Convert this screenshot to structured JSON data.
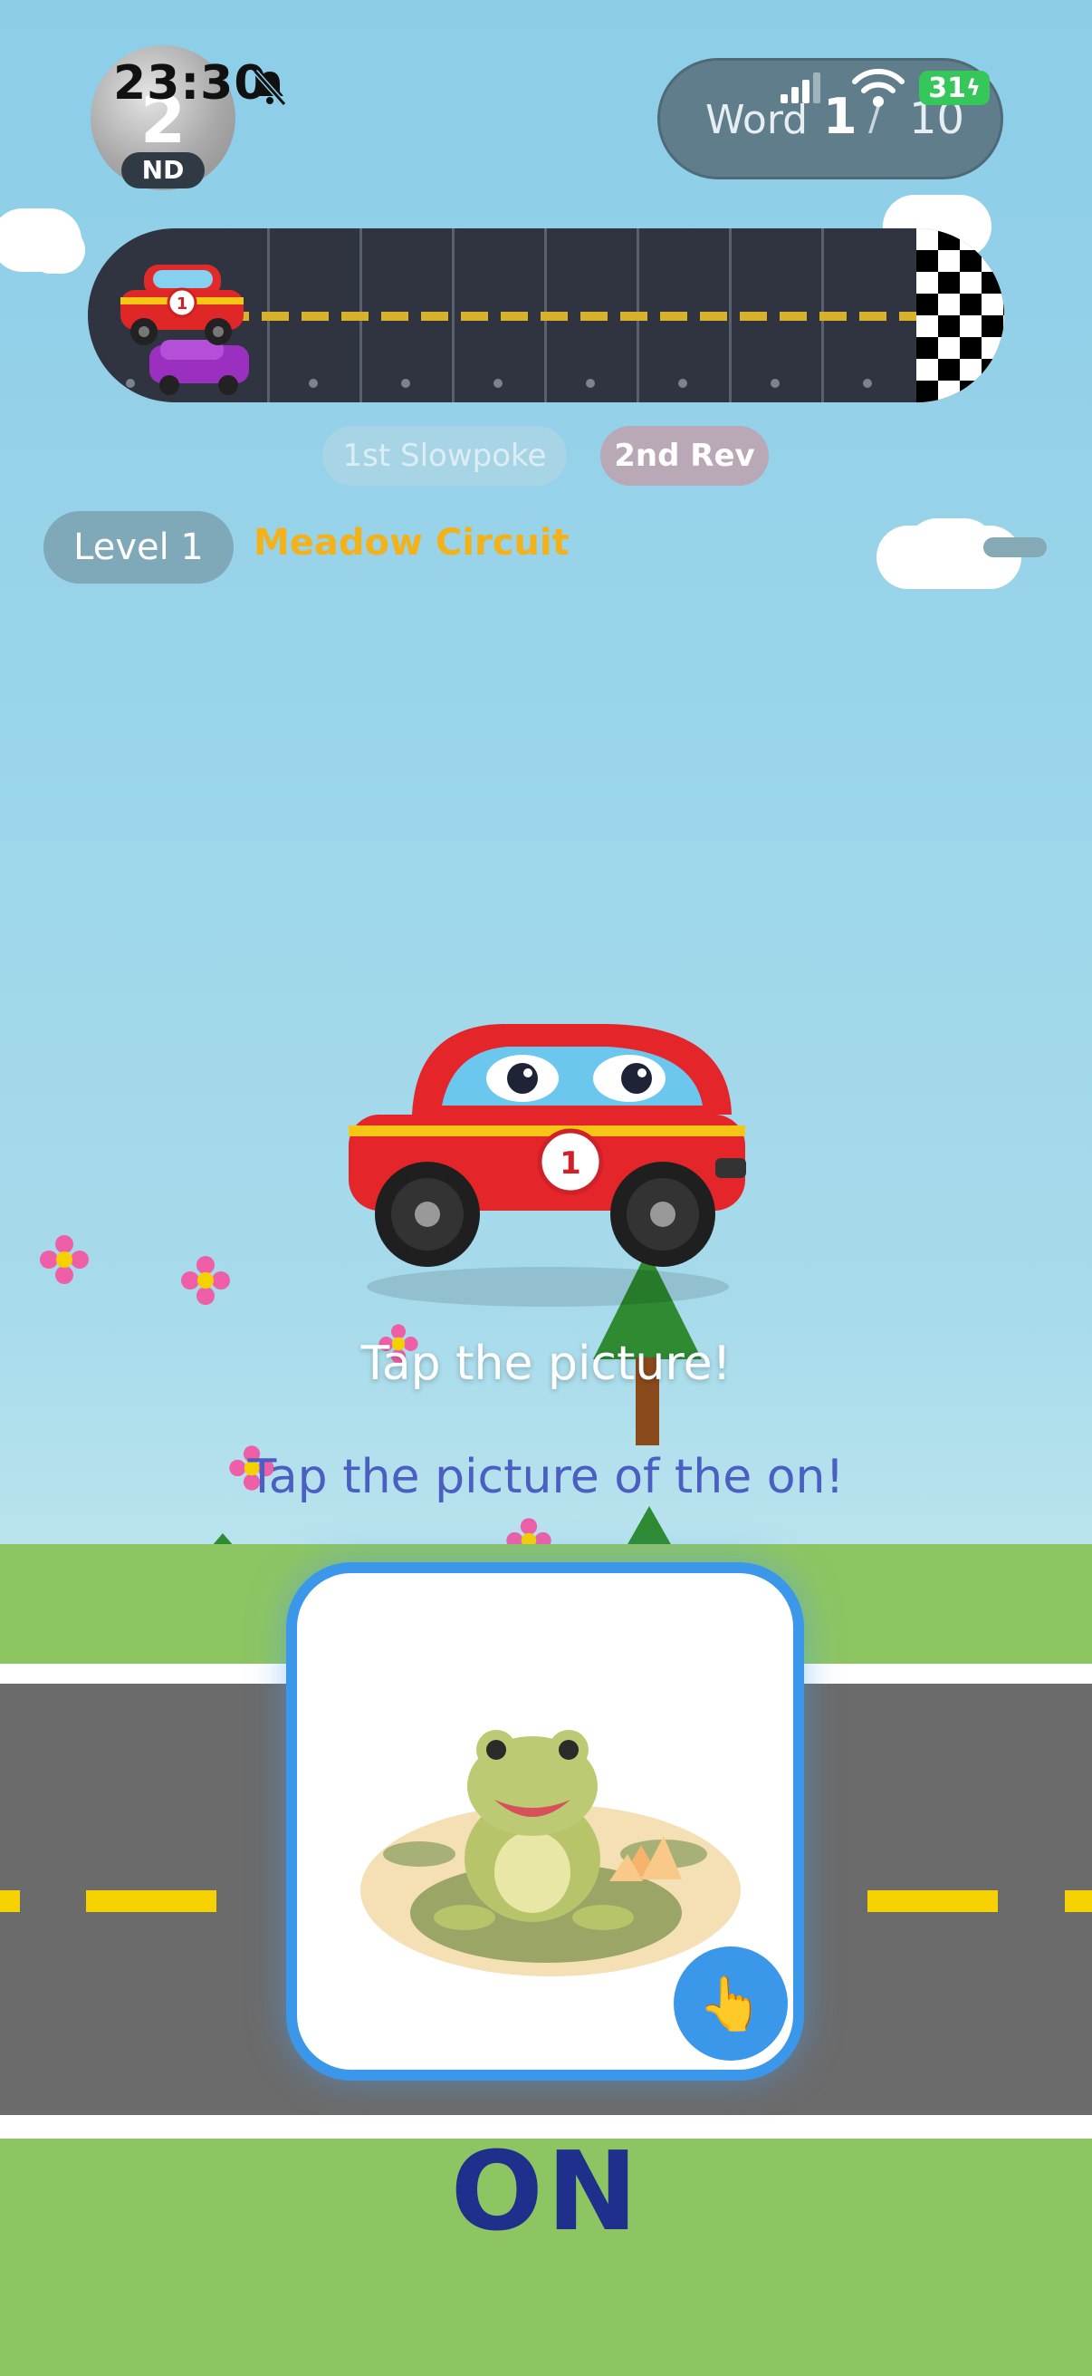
{
  "status_bar": {
    "time": "23:30",
    "battery": "31"
  },
  "race": {
    "position_number": "2",
    "position_suffix": "ND",
    "word_label": "Word",
    "word_current": "1",
    "word_separator": "/",
    "word_total": "10",
    "racers": [
      {
        "label": "1st Slowpoke"
      },
      {
        "label": "2nd Rev"
      }
    ],
    "player_car_number": "1"
  },
  "level": {
    "label": "Level 1",
    "name": "Meadow Circuit"
  },
  "prompt": {
    "main": "Tap the picture!",
    "sub": "Tap the picture of the on!"
  },
  "answer": {
    "word": "ON",
    "button_icon": "👆"
  },
  "colors": {
    "sky": "#8ccde8",
    "grass": "#8ec563",
    "road": "#6b6b6b",
    "accent_blue": "#3b97e9",
    "circuit_orange": "#f3b21b",
    "answer_navy": "#1e2f8c"
  },
  "icons": {
    "mute": "bell-slash-icon",
    "signal": "cellular-signal-icon",
    "wifi": "wifi-icon",
    "battery": "battery-charging-icon",
    "hand": "pointing-hand-icon"
  }
}
